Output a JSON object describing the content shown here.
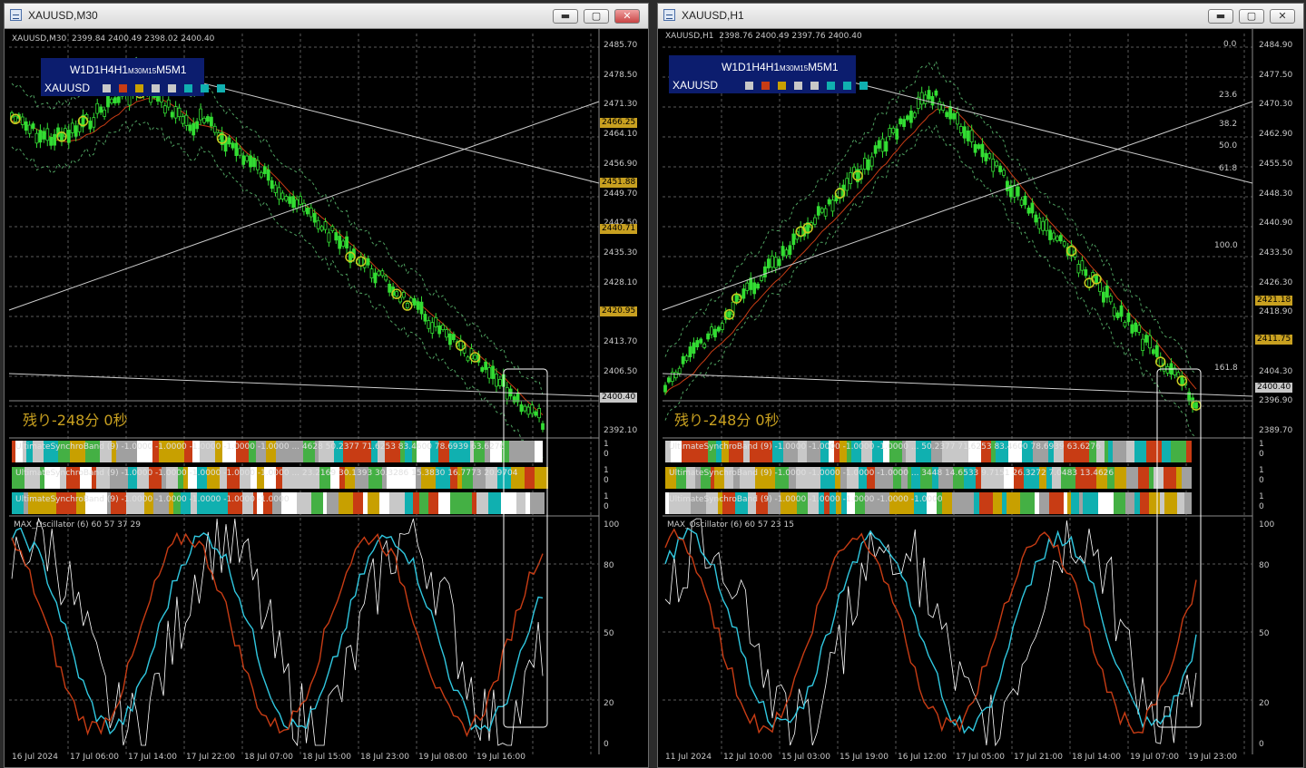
{
  "left": {
    "title": "XAUUSD,M30",
    "header": "XAUUSD,M30  2399.84 2400.49 2398.02 2400.40",
    "axis": [
      "2485.70",
      "2478.50",
      "2471.30",
      "2464.10",
      "2456.90",
      "2449.70",
      "2442.50",
      "2435.30",
      "2428.10",
      "2420.90",
      "2413.70",
      "2406.50",
      "2399.30",
      "2392.10"
    ],
    "price_boxes": [
      {
        "text": "2466.25",
        "color": "#c8a020"
      },
      {
        "text": "2451.88",
        "color": "#c8a020"
      },
      {
        "text": "2440.71",
        "color": "#c8a020"
      },
      {
        "text": "2420.95",
        "color": "#c8a020"
      },
      {
        "text": "2400.40",
        "color": "#c8c8c8"
      }
    ],
    "countdown": "残り-248分 0秒",
    "bands": [
      "UltimateSynchroBand (9) -1.0000 -1.0000 -1.0000 -1.0000 -1.0000 ... 4628 50.2377 71.6253 83.4600 78.6939 63.6276",
      "UltimateSynchroBand (9) -1.0000 -1.0000 -1.0000 -1.0000 -1.0000 ... 23.2169 30.1393 30.3286 15.3830 16.7773 20.9704",
      "UltimateSynchroBand (9) -1.0000 -1.0000 -1.0000 -1.0000 -1.0000"
    ],
    "band_axis": [
      "1",
      "0"
    ],
    "osc_header": "MAX_Oscillator (6) 60 57 37 29",
    "osc_axis": [
      "100",
      "80",
      "50",
      "20",
      "0"
    ],
    "dates": [
      "16 Jul 2024",
      "17 Jul 06:00",
      "17 Jul 14:00",
      "17 Jul 22:00",
      "18 Jul 07:00",
      "18 Jul 15:00",
      "18 Jul 23:00",
      "19 Jul 08:00",
      "19 Jul 16:00"
    ]
  },
  "right": {
    "title": "XAUUSD,H1",
    "header": "XAUUSD,H1  2398.76 2400.49 2397.76 2400.40",
    "axis": [
      "2484.90",
      "2477.50",
      "2470.30",
      "2462.90",
      "2455.50",
      "2448.30",
      "2440.90",
      "2433.50",
      "2426.30",
      "2418.90",
      "2411.50",
      "2404.30",
      "2396.90",
      "2389.70"
    ],
    "price_boxes": [
      {
        "text": "2421.18",
        "color": "#c8a020"
      },
      {
        "text": "2411.75",
        "color": "#c8a020"
      },
      {
        "text": "2400.40",
        "color": "#c8c8c8"
      }
    ],
    "fibo": [
      "0.0",
      "23.6",
      "38.2",
      "50.0",
      "61.8",
      "100.0",
      "161.8"
    ],
    "countdown": "残り-248分 0秒",
    "bands": [
      "UltimateSynchroBand (9) -1.0000 -1.0000 -1.0000 -1.0000 ... 50.2377 71.6253 83.4600 78.6939 63.6276",
      "UltimateSynchroBand (9) -1.0000 -1.0000 -1.0000 -1.0000 ... 3448 14.6533 9.7151 26.3272 7.0483 13.4626",
      "UltimateSynchroBand (9) -1.0000 -1.0000 -1.0000 -1.0000 -1.0000"
    ],
    "band_axis": [
      "1",
      "0"
    ],
    "osc_header": "MAX_Oscillator (6) 60 57 23 15",
    "osc_axis": [
      "100",
      "80",
      "50",
      "20",
      "0"
    ],
    "dates": [
      "11 Jul 2024",
      "12 Jul 10:00",
      "15 Jul 03:00",
      "15 Jul 19:00",
      "16 Jul 12:00",
      "17 Jul 05:00",
      "17 Jul 21:00",
      "18 Jul 14:00",
      "19 Jul 07:00",
      "19 Jul 23:00"
    ]
  },
  "tf_panel": {
    "timeframes": [
      "W1",
      "D1",
      "H4",
      "H1",
      "M30",
      "M15",
      "M5",
      "M1"
    ],
    "symbol": "XAUUSD",
    "colors": [
      "#c8c8c8",
      "#c83c14",
      "#c8a000",
      "#c8c8c8",
      "#c8c8c8",
      "#10b0b0",
      "#10b0b0",
      "#10b0b0"
    ]
  },
  "window_buttons": {
    "minimize": "▬",
    "maximize": "▢",
    "close": "✕"
  }
}
